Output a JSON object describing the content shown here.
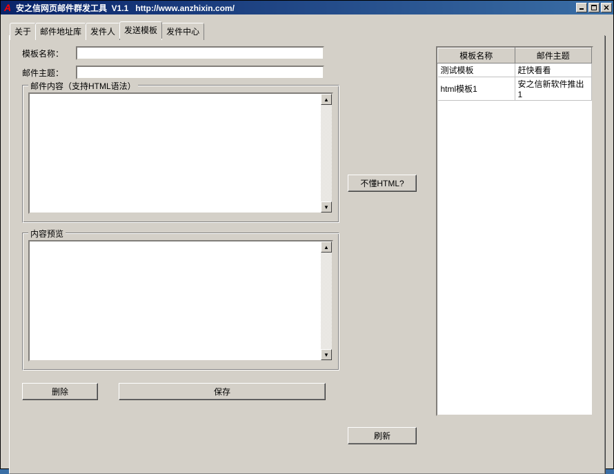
{
  "title": "安之信网页邮件群发工具  V1.1   http://www.anzhixin.com/",
  "tabs": [
    "关于",
    "邮件地址库",
    "发件人",
    "发送模板",
    "发件中心"
  ],
  "active_tab_index": 3,
  "form": {
    "template_name_label": "模板名称：",
    "template_name_value": "",
    "mail_subject_label": "邮件主题：",
    "mail_subject_value": ""
  },
  "content_group_label": "邮件内容（支持HTML语法）",
  "preview_group_label": "内容预览",
  "help_button": "不懂HTML?",
  "buttons": {
    "delete": "删除",
    "save": "保存",
    "refresh": "刷新"
  },
  "table": {
    "headers": [
      "模板名称",
      "邮件主题"
    ],
    "rows": [
      [
        "测试模板",
        "赶快看看"
      ],
      [
        "html模板1",
        "安之信新软件推出1"
      ]
    ]
  },
  "window_controls": {
    "min": "_",
    "max": "□",
    "close": "✕"
  }
}
